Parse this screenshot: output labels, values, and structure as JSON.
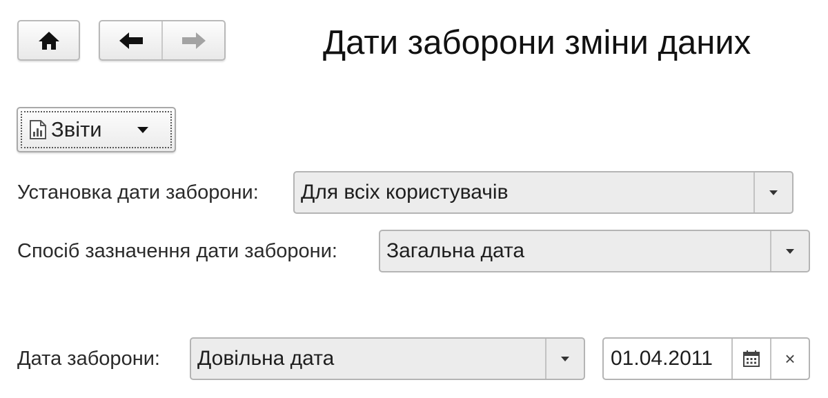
{
  "window": {
    "title": "Дати заборони зміни даних"
  },
  "toolbar": {
    "home_icon": "home-icon",
    "back_icon": "arrow-left-icon",
    "forward_icon": "arrow-right-icon"
  },
  "reports": {
    "label": "Звіти",
    "icon": "report-chart-icon",
    "dropdown_icon": "triangle-down-icon"
  },
  "form": {
    "set_date": {
      "label": "Установка дати заборони:",
      "value": "Для всіх користувачів"
    },
    "method": {
      "label": "Спосіб зазначення дати заборони:",
      "value": "Загальна дата"
    },
    "ban_date": {
      "label": "Дата заборони:",
      "value": "Довільна дата",
      "date": "01.04.2011",
      "calendar_icon": "calendar-icon",
      "clear_glyph": "×"
    }
  },
  "colors": {
    "background": "#ffffff",
    "field_bg": "#ececec",
    "border": "#b4b4b4",
    "text": "#222222"
  }
}
